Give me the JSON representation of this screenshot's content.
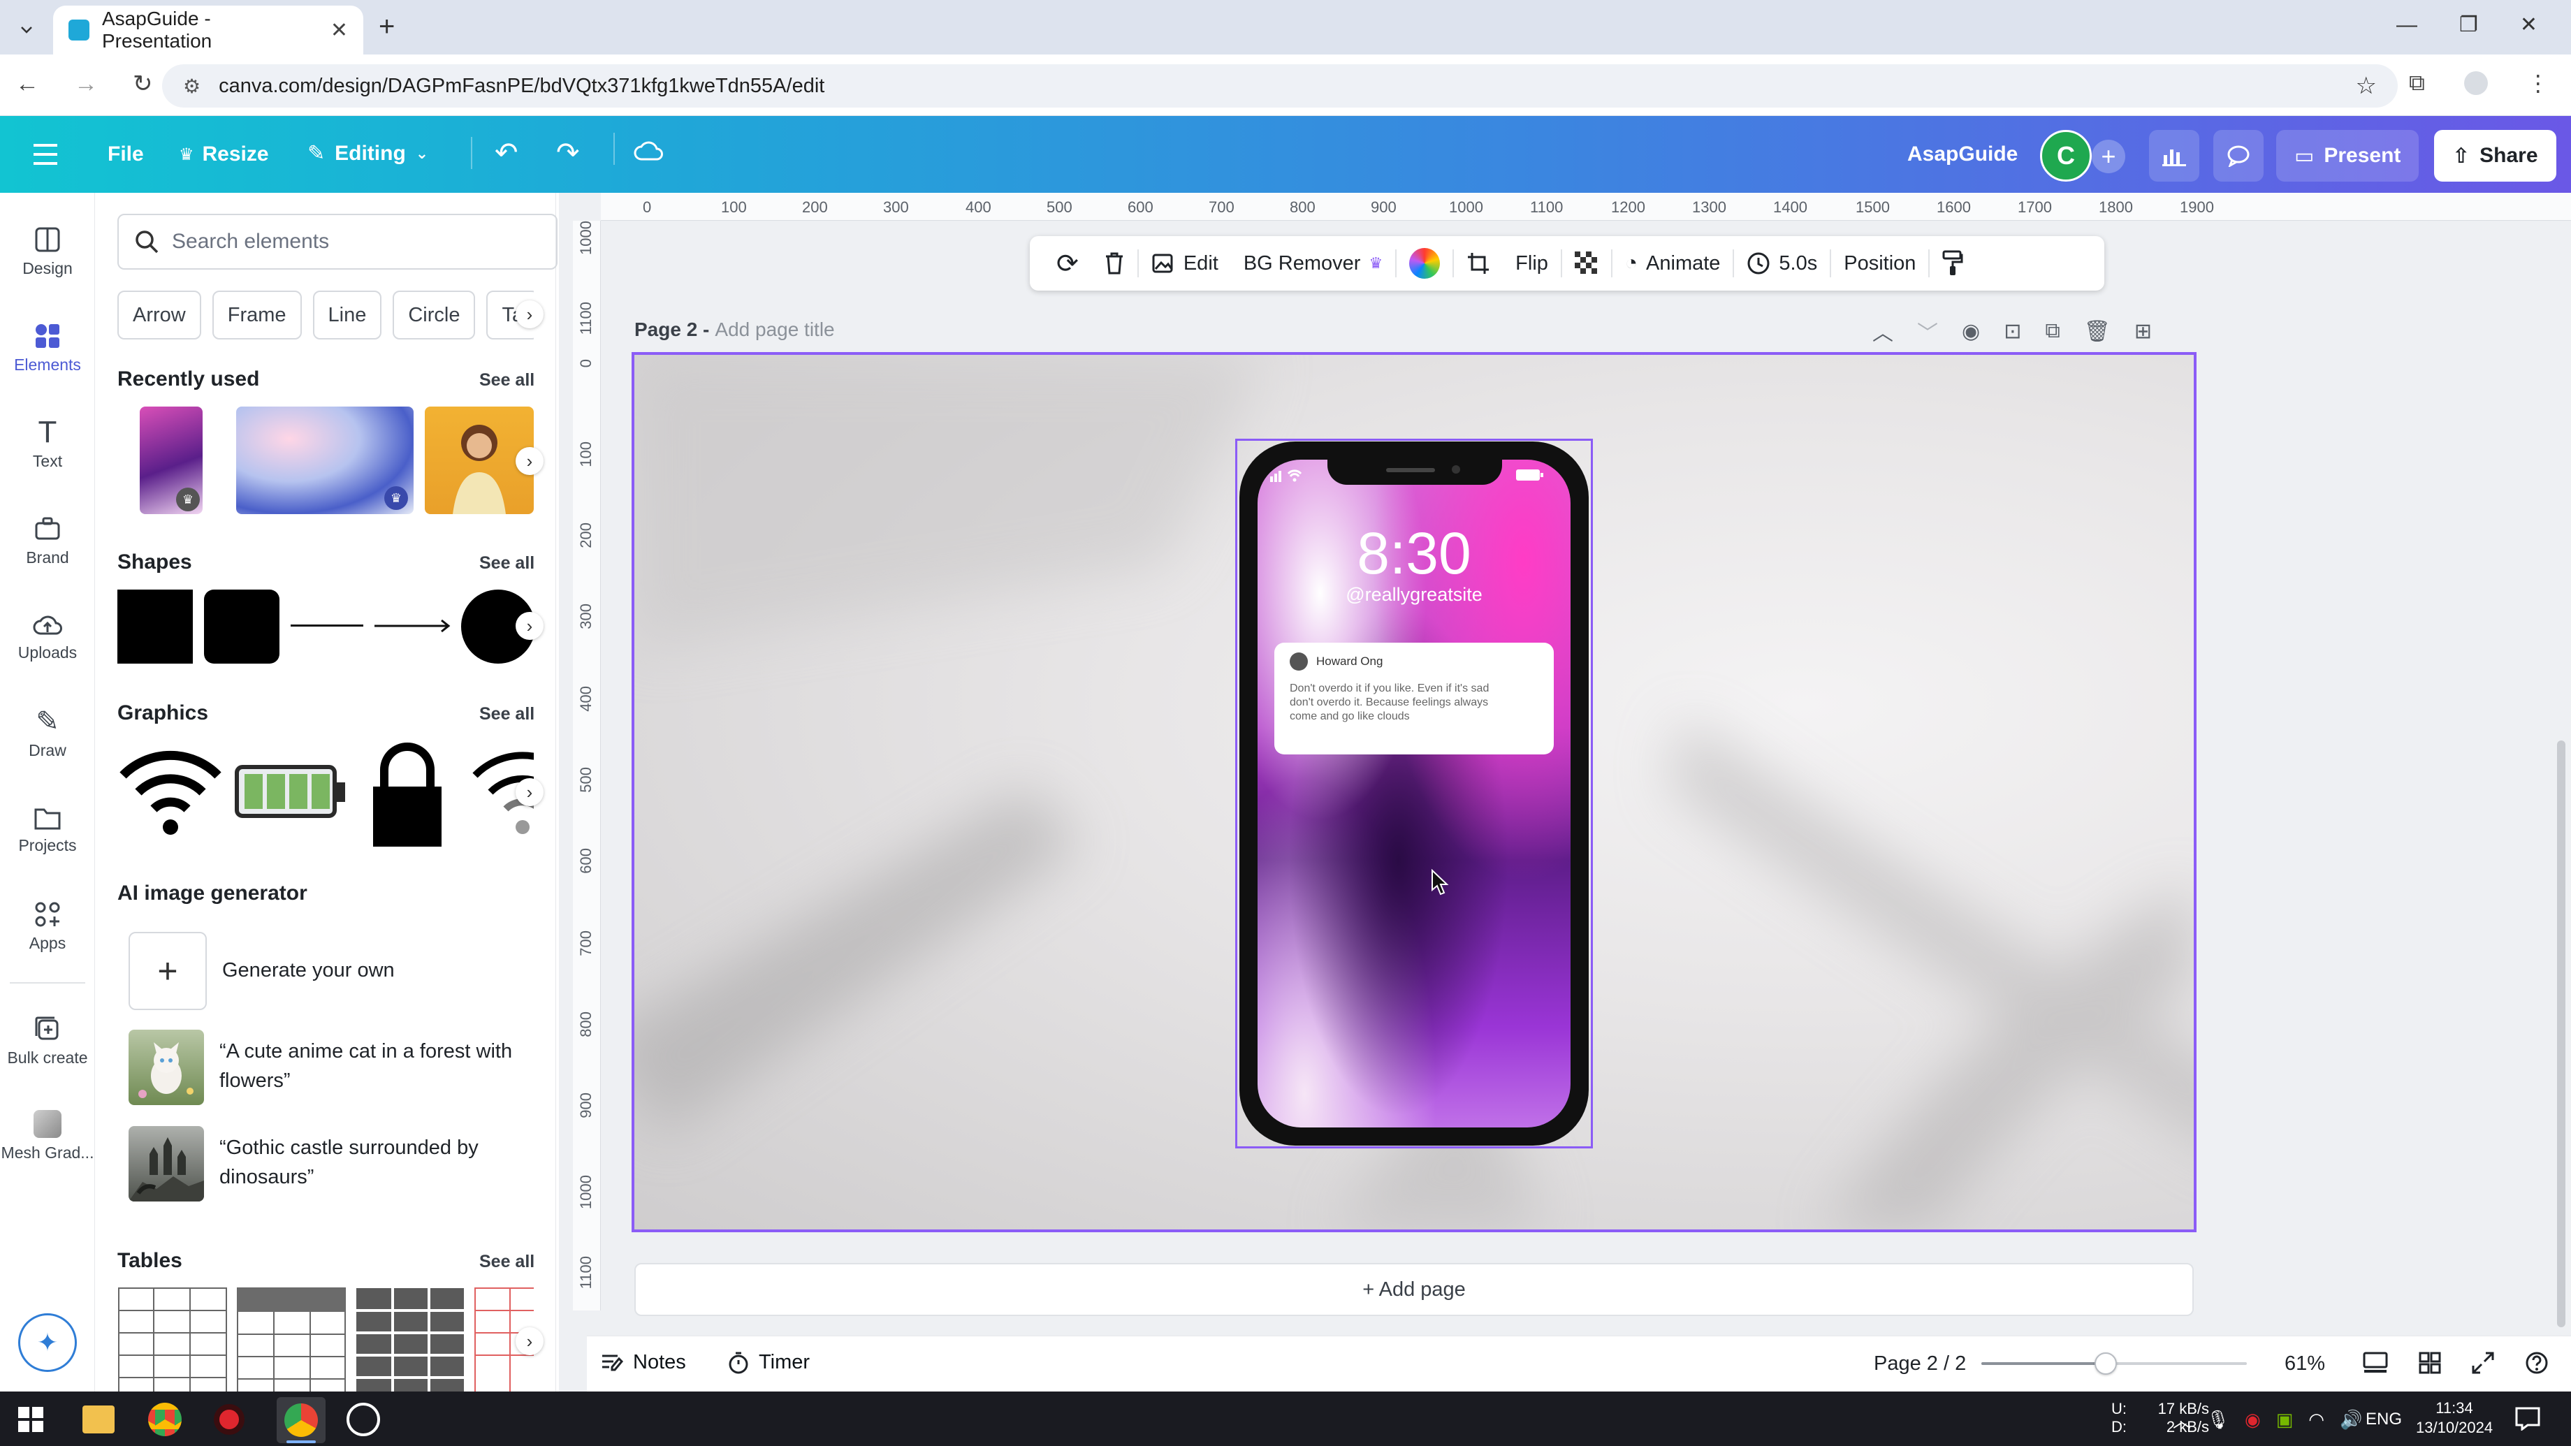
{
  "browser": {
    "tab_title": "AsapGuide - Presentation",
    "url": "canva.com/design/DAGPmFasnPE/bdVQtx371kfg1kweTdn55A/edit"
  },
  "header": {
    "file": "File",
    "resize": "Resize",
    "editing": "Editing",
    "team": "AsapGuide",
    "avatar_letter": "C",
    "present": "Present",
    "share": "Share"
  },
  "rail": {
    "design": "Design",
    "elements": "Elements",
    "text": "Text",
    "brand": "Brand",
    "uploads": "Uploads",
    "draw": "Draw",
    "projects": "Projects",
    "apps": "Apps",
    "bulk_create": "Bulk create",
    "mesh_grad": "Mesh Grad..."
  },
  "panel": {
    "search_placeholder": "Search elements",
    "chips": [
      "Arrow",
      "Frame",
      "Line",
      "Circle",
      "Ta"
    ],
    "recently_used": "Recently used",
    "shapes": "Shapes",
    "graphics": "Graphics",
    "ai_generator": "AI image generator",
    "generate_own": "Generate your own",
    "prompt1_line1": "“A cute anime cat in a forest with",
    "prompt1_line2": "flowers”",
    "prompt2_line1": "“Gothic castle surrounded by",
    "prompt2_line2": "dinosaurs”",
    "tables": "Tables",
    "see_all": "See all"
  },
  "ruler": {
    "top": [
      "0",
      "100",
      "200",
      "300",
      "400",
      "500",
      "600",
      "700",
      "800",
      "900",
      "1000",
      "1100",
      "1200",
      "1300",
      "1400",
      "1500",
      "1600",
      "1700",
      "1800",
      "1900"
    ],
    "left": [
      "1000",
      "1100",
      "0",
      "100",
      "200",
      "300",
      "400",
      "500",
      "600",
      "700",
      "800",
      "900",
      "1000",
      "1100"
    ]
  },
  "toolbar": {
    "edit": "Edit",
    "bg_remover": "BG Remover",
    "flip": "Flip",
    "animate": "Animate",
    "duration": "5.0s",
    "position": "Position"
  },
  "page": {
    "label": "Page 2 -",
    "title_placeholder": "Add page title",
    "add_page": "+ Add page"
  },
  "phone": {
    "time": "8:30",
    "handle": "@reallygreatsite",
    "notif_name": "Howard Ong",
    "notif_line1": "Don't overdo it if you like. Even if it's sad",
    "notif_line2": "don't overdo it. Because feelings always",
    "notif_line3": "come and go like clouds"
  },
  "bottom": {
    "notes": "Notes",
    "timer": "Timer",
    "page_indicator": "Page 2 / 2",
    "zoom": "61%"
  },
  "taskbar": {
    "net_up_label": "U:",
    "net_down_label": "D:",
    "net_up": "17 kB/s",
    "net_down": "2 kB/s",
    "lang": "ENG",
    "time": "11:34",
    "date": "13/10/2024"
  },
  "colors": {
    "accent": "#8b5cf6",
    "header_start": "#12c4d2",
    "header_end": "#6a58e6",
    "avatar": "#1fa84f"
  }
}
